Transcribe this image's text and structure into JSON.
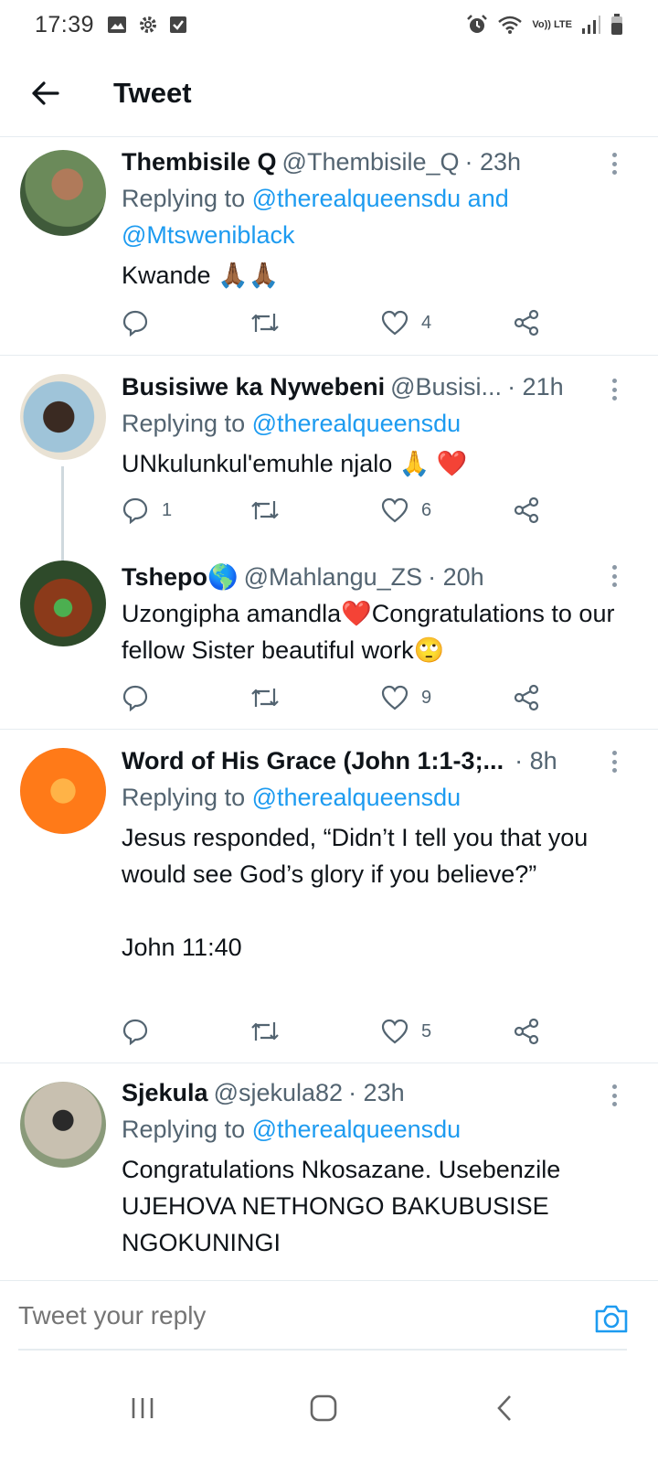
{
  "status_bar": {
    "time": "17:39",
    "network": "Vo)) LTE"
  },
  "header": {
    "title": "Tweet"
  },
  "replying_prefix": "Replying to ",
  "tweets": [
    {
      "name": "Thembisile Q",
      "handle": "@Thembisile_Q",
      "time": "· 23h",
      "replying_to": "@therealqueensdu and @Mtsweniblack",
      "text": "Kwande 🙏🏾🙏🏾",
      "replies": "",
      "likes": "4"
    },
    {
      "name": "Busisiwe ka Nywebeni",
      "handle": "@Busisi...",
      "time": "· 21h",
      "replying_to": "@therealqueensdu",
      "text": "UNkulunkul'emuhle njalo 🙏 ❤️",
      "replies": "1",
      "likes": "6"
    },
    {
      "name": "Tshepo🌎",
      "handle": "@Mahlangu_ZS",
      "time": "· 20h",
      "replying_to": "",
      "text": "Uzongipha amandla❤️Congratulations to our fellow Sister beautiful work🙄",
      "replies": "",
      "likes": "9"
    },
    {
      "name": "Word of His Grace (John 1:1-3;...",
      "handle": "",
      "time": "· 8h",
      "replying_to": "@therealqueensdu",
      "text": "Jesus responded, “Didn’t I tell you that you would see God’s glory if you believe?”\n\nJohn 11:40",
      "replies": "",
      "likes": "5"
    },
    {
      "name": "Sjekula",
      "handle": "@sjekula82",
      "time": "· 23h",
      "replying_to": "@therealqueensdu",
      "text": "Congratulations Nkosazane. Usebenzile UJEHOVA NETHONGO BAKUBUSISE NGOKUNINGI",
      "replies": "",
      "likes": ""
    }
  ],
  "reply_bar": {
    "placeholder": "Tweet your reply"
  },
  "colors": {
    "accent": "#1d9bf0",
    "text": "#0f1419",
    "muted": "#536471",
    "divider": "#e6ecf0"
  }
}
